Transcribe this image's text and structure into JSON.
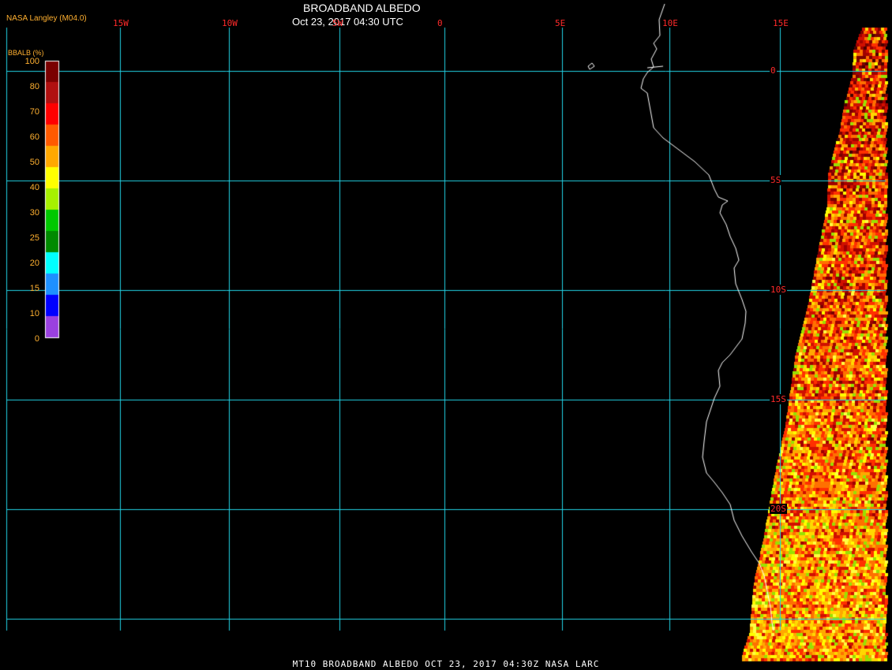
{
  "header": {
    "title": "BROADBAND ALBEDO",
    "datetime": "Oct 23, 2017 04:30 UTC",
    "credit": "NASA Langley (M04.0)"
  },
  "colorbar": {
    "title": "BBALB (%)",
    "labels": [
      "100",
      "80",
      "70",
      "60",
      "50",
      "40",
      "30",
      "25",
      "20",
      "15",
      "10",
      "0"
    ],
    "colors": [
      "#7a0000",
      "#b01010",
      "#ff0000",
      "#ff5a00",
      "#ffa800",
      "#ffff00",
      "#a6f000",
      "#00c800",
      "#008a00",
      "#00ffff",
      "#1e90ff",
      "#0000ff",
      "#9a40e0"
    ]
  },
  "map": {
    "longitude_ticks": [
      "15W",
      "10W",
      "5W",
      "0",
      "5E",
      "10E",
      "15E"
    ],
    "latitude_ticks": [
      "0",
      "5S",
      "10S",
      "15S",
      "20S"
    ],
    "grid_color": "#22d3e6",
    "coast_color": "#ffffff"
  },
  "footer": {
    "text": "MT10  BROADBAND ALBEDO   OCT 23, 2017 04:30Z   NASA LARC"
  }
}
